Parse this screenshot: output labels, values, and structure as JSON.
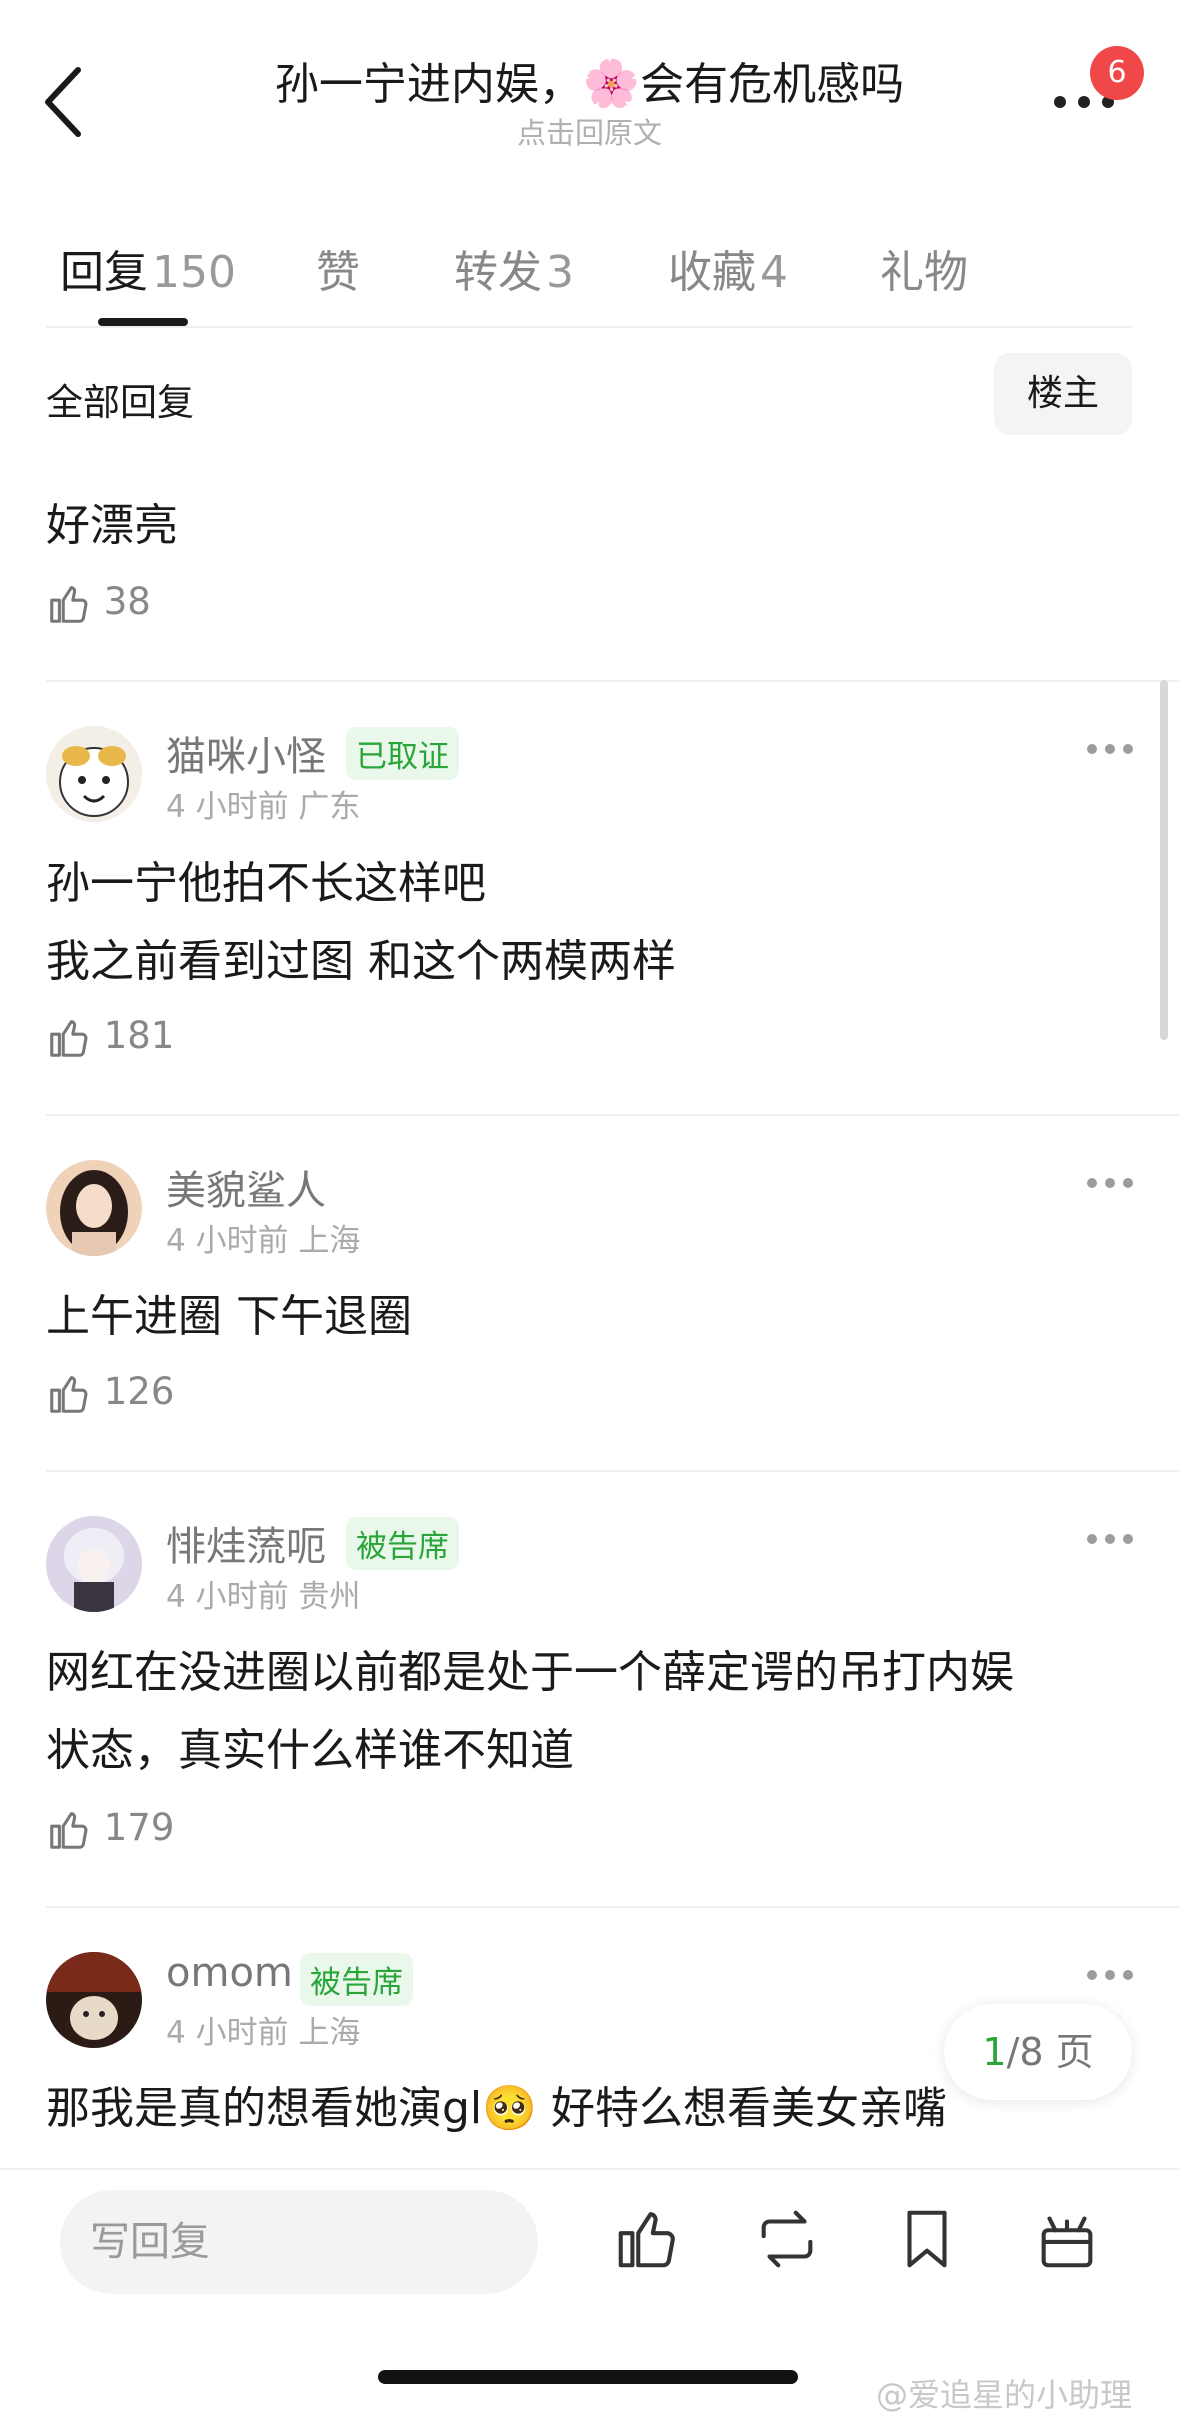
{
  "header": {
    "title_prefix": "孙一宁进内娱，",
    "title_emoji": "🌸",
    "title_suffix": "会有危机感吗",
    "subtitle": "点击回原文",
    "notification_count": "6"
  },
  "tabs": [
    {
      "label": "回复",
      "count": "150"
    },
    {
      "label": "赞",
      "count": ""
    },
    {
      "label": "转发",
      "count": "3"
    },
    {
      "label": "收藏",
      "count": "4"
    },
    {
      "label": "礼物",
      "count": ""
    }
  ],
  "filter": {
    "all_replies": "全部回复",
    "op_button": "楼主"
  },
  "comments": [
    {
      "text": "好漂亮",
      "likes": "38"
    },
    {
      "username": "猫咪小怪",
      "badge": "已取证",
      "meta": "4 小时前 广东",
      "lines": [
        "孙一宁他拍不长这样吧",
        "我之前看到过图 和这个两模两样"
      ],
      "likes": "181"
    },
    {
      "username": "美貌鲨人",
      "badge": "",
      "meta": "4 小时前 上海",
      "lines": [
        "上午进圈 下午退圈"
      ],
      "likes": "126"
    },
    {
      "username": "悱烓蓅呃",
      "badge": "被告席",
      "meta": "4 小时前 贵州",
      "lines": [
        "网红在没进圈以前都是处于一个薛定谔的吊打内娱",
        "状态，真实什么样谁不知道"
      ],
      "likes": "179"
    },
    {
      "username": "omom",
      "badge": "被告席",
      "meta": "4 小时前 上海",
      "text_before_emoji": "那我是真的想看她演gl",
      "emoji": "🥺",
      "text_after_emoji": " 好特么想看美女亲嘴"
    }
  ],
  "pagination": {
    "current": "1",
    "total": "/8 页"
  },
  "bottom_bar": {
    "reply_placeholder": "写回复"
  },
  "watermark": "@爱追星的小助理",
  "colors": {
    "accent_green": "#2aa53a",
    "badge_bg": "#e9f8eb",
    "notif_red": "#f04848"
  }
}
